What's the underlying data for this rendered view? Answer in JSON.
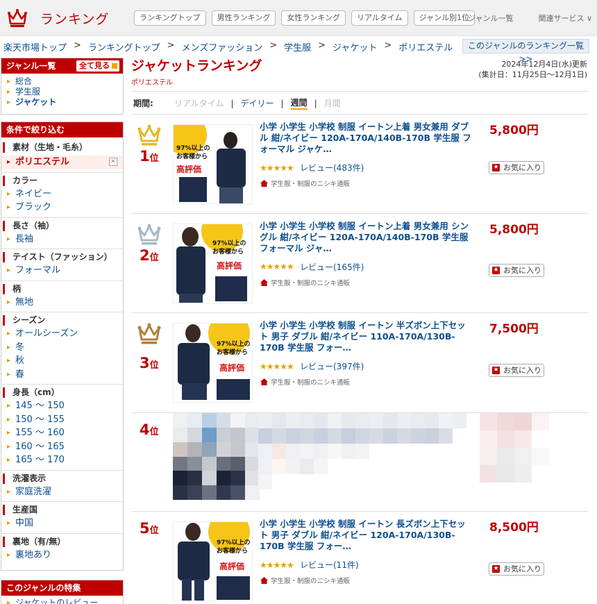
{
  "header": {
    "logo_text": "ランキング",
    "nav": [
      "ランキングトップ",
      "男性ランキング",
      "女性ランキング",
      "リアルタイム",
      "ジャンル別1位"
    ],
    "right_links": [
      "ジャンル一覧",
      "関連サービス ∨"
    ]
  },
  "breadcrumb": [
    "楽天市場トップ",
    "ランキングトップ",
    "メンズファッション",
    "学生服",
    "ジャケット",
    "ポリエステル"
  ],
  "breadcrumb_sep": ">",
  "genre_ranking_link": "このジャンルのランキング一覧 >>",
  "sidebar": {
    "genre_title": "ジャンル一覧",
    "show_all": "全て見る",
    "genres": [
      "総合",
      "学生服",
      "ジャケット"
    ],
    "filter_title": "条件で絞り込む",
    "filters": [
      {
        "title": "素材（生地・毛糸）",
        "items": [
          "ポリエステル"
        ],
        "selected": 0
      },
      {
        "title": "カラー",
        "items": [
          "ネイビー",
          "ブラック"
        ]
      },
      {
        "title": "長さ（袖）",
        "items": [
          "長袖"
        ]
      },
      {
        "title": "テイスト（ファッション）",
        "items": [
          "フォーマル"
        ]
      },
      {
        "title": "柄",
        "items": [
          "無地"
        ]
      },
      {
        "title": "シーズン",
        "items": [
          "オールシーズン",
          "冬",
          "秋",
          "春"
        ]
      },
      {
        "title": "身長（cm）",
        "items": [
          "145 ～ 150",
          "150 ～ 155",
          "155 ～ 160",
          "160 ～ 165",
          "165 ～ 170"
        ]
      },
      {
        "title": "洗濯表示",
        "items": [
          "家庭洗濯"
        ]
      },
      {
        "title": "生産国",
        "items": [
          "中国"
        ]
      },
      {
        "title": "裏地（有/無）",
        "items": [
          "裏地あり"
        ]
      }
    ],
    "feature_title": "このジャンルの特集",
    "feature_item": "ジャケットのレビュー"
  },
  "main": {
    "title": "ジャケットランキング",
    "subtitle": "ポリエステル",
    "updated": "2024年12月4日(水)更新",
    "period_range": "(集計日：11月25日～12月1日)",
    "period_label": "期間:",
    "periods": [
      "リアルタイム",
      "デイリー",
      "週間",
      "月間"
    ],
    "active_period": "週間"
  },
  "items": [
    {
      "rank": "1",
      "rank_suffix": "位",
      "title": "小学 小学生 小学校 制服 イートン上着 男女兼用 ダブル 紺/ネイビー 120A-170A/140B-170B 学生服 フォーマル ジャケ…",
      "stars": "★★★★★",
      "reviews": "レビュー(483件)",
      "shop": "学生服・制服のニシキ通販",
      "price": "5,800円",
      "fav": "お気に入り",
      "crown_color": "#e5b825"
    },
    {
      "rank": "2",
      "rank_suffix": "位",
      "title": "小学 小学生 小学校 制服 イートン上着 男女兼用 シングル 紺/ネイビー 120A-170A/140B-170B 学生服 フォーマル ジャ…",
      "stars": "★★★★★",
      "reviews": "レビュー(165件)",
      "shop": "学生服・制服のニシキ通販",
      "price": "5,800円",
      "fav": "お気に入り",
      "crown_color": "#a9b7c6"
    },
    {
      "rank": "3",
      "rank_suffix": "位",
      "title": "小学 小学生 小学校 制服 イートン 半ズボン上下セット 男子 ダブル 紺/ネイビー 110A-170A/130B-170B 学生服 フォー…",
      "stars": "★★★★★",
      "reviews": "レビュー(397件)",
      "shop": "学生服・制服のニシキ通販",
      "price": "7,500円",
      "fav": "お気に入り",
      "crown_color": "#b08038"
    },
    {
      "rank": "4",
      "rank_suffix": "位"
    },
    {
      "rank": "5",
      "rank_suffix": "位",
      "title": "小学 小学生 小学校 制服 イートン 長ズボン上下セット 男子 ダブル 紺/ネイビー 120A-170A/130B-170B 学生服 フォー…",
      "stars": "★★★★★",
      "reviews": "レビュー(11件)",
      "shop": "学生服・制服のニシキ通販",
      "price": "8,500円",
      "fav": "お気に入り"
    }
  ],
  "thumb_text": {
    "line1": "97%以上の",
    "line2": "お客様から",
    "line3": "高評価"
  },
  "colors": {
    "brand_red": "#bf0000",
    "link_blue": "#0c4f8f",
    "star_gold": "#e3a300"
  }
}
